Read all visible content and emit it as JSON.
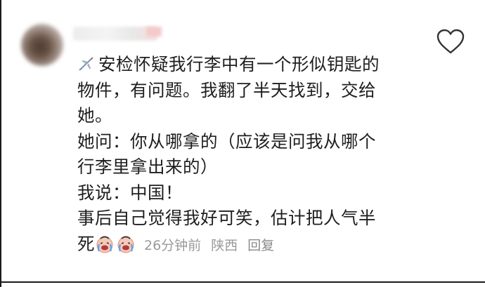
{
  "comment": {
    "lines": [
      "安检怀疑我行李中有一个形似钥匙的",
      "物件，有问题。我翻了半天找到，交给",
      "她。",
      "她问：你从哪拿的（应该是问我从哪个",
      "行李里拿出来的）",
      "我说：中国！",
      "事后自己觉得我好可笑，估计把人气半",
      "死"
    ],
    "leading_icon": "airplane-icon",
    "trailing_emojis": [
      "crying-laughing-emoji",
      "crying-laughing-emoji"
    ]
  },
  "meta": {
    "time": "26分钟前",
    "location": "陕西",
    "reply_label": "回复"
  },
  "icons": {
    "like": "heart-outline-icon"
  },
  "colors": {
    "text": "#1e1e1e",
    "meta": "#9a9a9a",
    "heart": "#333333"
  }
}
